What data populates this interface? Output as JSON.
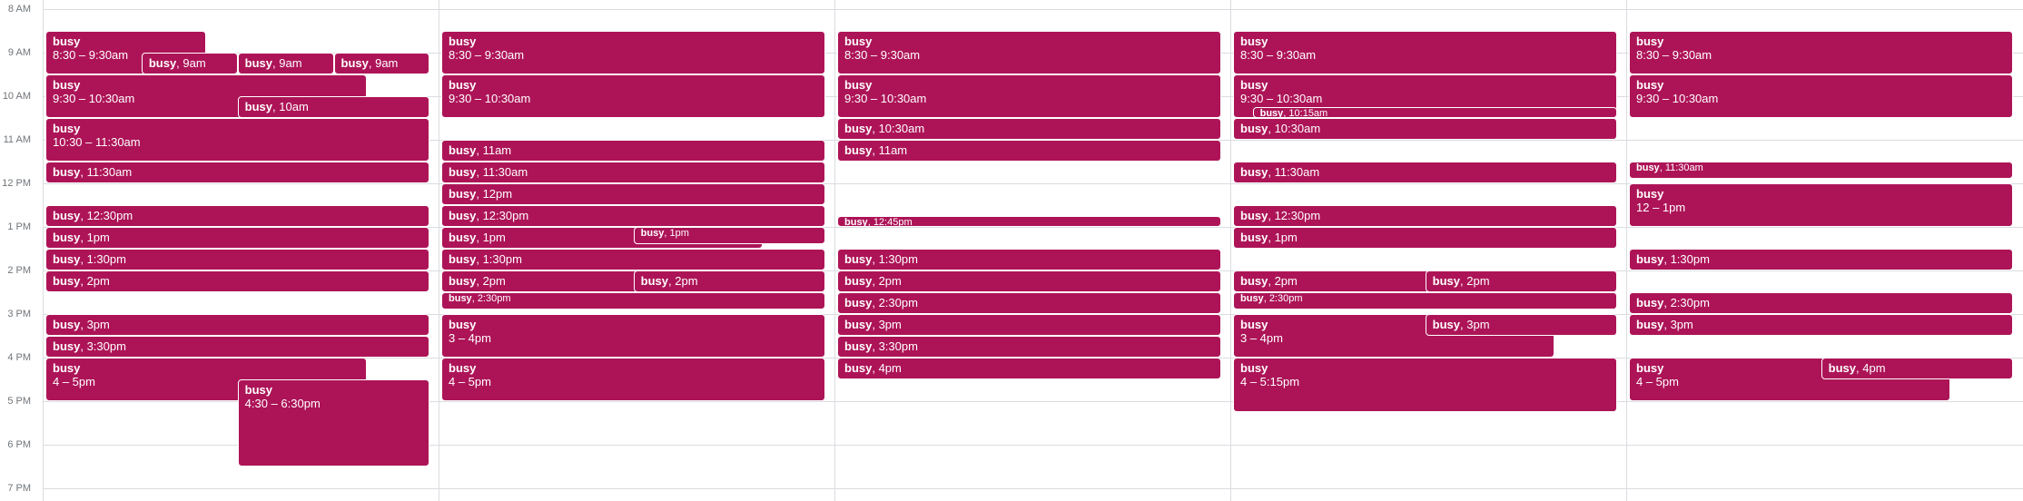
{
  "time_labels": [
    "8 AM",
    "9 AM",
    "10 AM",
    "11 AM",
    "12 PM",
    "1 PM",
    "2 PM",
    "3 PM",
    "4 PM",
    "5 PM",
    "6 PM",
    "7 PM"
  ],
  "event_title": "busy",
  "accent_color": "#ad1457",
  "days": [
    {
      "events": [
        {
          "title": "busy",
          "time": "8:30 – 9:30am",
          "start": 8.5,
          "end": 9.5,
          "lane": 0,
          "width": 0.41
        },
        {
          "title": "busy",
          "time": "9am",
          "start": 9.0,
          "end": 9.5,
          "lane": 0.245,
          "width": 0.245
        },
        {
          "title": "busy",
          "time": "9am",
          "start": 9.0,
          "end": 9.5,
          "lane": 0.49,
          "width": 0.245
        },
        {
          "title": "busy",
          "time": "9am",
          "start": 9.0,
          "end": 9.5,
          "lane": 0.735,
          "width": 0.245
        },
        {
          "title": "busy",
          "time": "9:30 – 10:30am",
          "start": 9.5,
          "end": 10.5,
          "lane": 0,
          "width": 0.82
        },
        {
          "title": "busy",
          "time": "10am",
          "start": 10.0,
          "end": 10.5,
          "lane": 0.49,
          "width": 0.49
        },
        {
          "title": "busy",
          "time": "10:30 – 11:30am",
          "start": 10.5,
          "end": 11.5,
          "lane": 0,
          "width": 0.98
        },
        {
          "title": "busy",
          "time": "11:30am",
          "start": 11.5,
          "end": 12.0,
          "lane": 0,
          "width": 0.98
        },
        {
          "title": "busy",
          "time": "12:30pm",
          "start": 12.5,
          "end": 13.0,
          "lane": 0,
          "width": 0.98
        },
        {
          "title": "busy",
          "time": "1pm",
          "start": 13.0,
          "end": 13.5,
          "lane": 0,
          "width": 0.98
        },
        {
          "title": "busy",
          "time": "1:30pm",
          "start": 13.5,
          "end": 14.0,
          "lane": 0,
          "width": 0.98
        },
        {
          "title": "busy",
          "time": "2pm",
          "start": 14.0,
          "end": 14.5,
          "lane": 0,
          "width": 0.98
        },
        {
          "title": "busy",
          "time": "3pm",
          "start": 15.0,
          "end": 15.5,
          "lane": 0,
          "width": 0.98
        },
        {
          "title": "busy",
          "time": "3:30pm",
          "start": 15.5,
          "end": 16.0,
          "lane": 0,
          "width": 0.98
        },
        {
          "title": "busy",
          "time": "4 – 5pm",
          "start": 16.0,
          "end": 17.0,
          "lane": 0,
          "width": 0.82
        },
        {
          "title": "busy",
          "time": "4:30 – 6:30pm",
          "start": 16.5,
          "end": 18.5,
          "lane": 0.49,
          "width": 0.49
        }
      ]
    },
    {
      "events": [
        {
          "title": "busy",
          "time": "8:30 – 9:30am",
          "start": 8.5,
          "end": 9.5,
          "lane": 0,
          "width": 0.98
        },
        {
          "title": "busy",
          "time": "9:30 – 10:30am",
          "start": 9.5,
          "end": 10.5,
          "lane": 0,
          "width": 0.98
        },
        {
          "title": "busy",
          "time": "11am",
          "start": 11.0,
          "end": 11.5,
          "lane": 0,
          "width": 0.98
        },
        {
          "title": "busy",
          "time": "11:30am",
          "start": 11.5,
          "end": 12.0,
          "lane": 0,
          "width": 0.98
        },
        {
          "title": "busy",
          "time": "12pm",
          "start": 12.0,
          "end": 12.5,
          "lane": 0,
          "width": 0.98
        },
        {
          "title": "busy",
          "time": "12:30pm",
          "start": 12.5,
          "end": 13.0,
          "lane": 0,
          "width": 0.98
        },
        {
          "title": "busy",
          "time": "1pm",
          "start": 13.0,
          "end": 13.5,
          "lane": 0,
          "width": 0.82
        },
        {
          "title": "busy",
          "time": "1pm",
          "start": 13.0,
          "end": 13.4,
          "lane": 0.49,
          "width": 0.49,
          "tiny": true
        },
        {
          "title": "busy",
          "time": "1:30pm",
          "start": 13.5,
          "end": 14.0,
          "lane": 0,
          "width": 0.98
        },
        {
          "title": "busy",
          "time": "2pm",
          "start": 14.0,
          "end": 14.5,
          "lane": 0,
          "width": 0.98
        },
        {
          "title": "busy",
          "time": "2pm",
          "start": 14.0,
          "end": 14.5,
          "lane": 0.49,
          "width": 0.49
        },
        {
          "title": "busy",
          "time": "2:30pm",
          "start": 14.5,
          "end": 14.9,
          "lane": 0,
          "width": 0.98,
          "tiny": true
        },
        {
          "title": "busy",
          "time": "3 – 4pm",
          "start": 15.0,
          "end": 16.0,
          "lane": 0,
          "width": 0.98
        },
        {
          "title": "busy",
          "time": "4 – 5pm",
          "start": 16.0,
          "end": 17.0,
          "lane": 0,
          "width": 0.98
        }
      ]
    },
    {
      "events": [
        {
          "title": "busy",
          "time": "8:30 – 9:30am",
          "start": 8.5,
          "end": 9.5,
          "lane": 0,
          "width": 0.98
        },
        {
          "title": "busy",
          "time": "9:30 – 10:30am",
          "start": 9.5,
          "end": 10.5,
          "lane": 0,
          "width": 0.98
        },
        {
          "title": "busy",
          "time": "10:30am",
          "start": 10.5,
          "end": 11.0,
          "lane": 0,
          "width": 0.98
        },
        {
          "title": "busy",
          "time": "11am",
          "start": 11.0,
          "end": 11.5,
          "lane": 0,
          "width": 0.98
        },
        {
          "title": "busy",
          "time": "12:45pm",
          "start": 12.75,
          "end": 13.0,
          "lane": 0,
          "width": 0.98,
          "tiny": true
        },
        {
          "title": "busy",
          "time": "1:30pm",
          "start": 13.5,
          "end": 14.0,
          "lane": 0,
          "width": 0.98
        },
        {
          "title": "busy",
          "time": "2pm",
          "start": 14.0,
          "end": 14.5,
          "lane": 0,
          "width": 0.98
        },
        {
          "title": "busy",
          "time": "2:30pm",
          "start": 14.5,
          "end": 15.0,
          "lane": 0,
          "width": 0.98
        },
        {
          "title": "busy",
          "time": "3pm",
          "start": 15.0,
          "end": 15.5,
          "lane": 0,
          "width": 0.98
        },
        {
          "title": "busy",
          "time": "3:30pm",
          "start": 15.5,
          "end": 16.0,
          "lane": 0,
          "width": 0.98
        },
        {
          "title": "busy",
          "time": "4pm",
          "start": 16.0,
          "end": 16.5,
          "lane": 0,
          "width": 0.98
        }
      ]
    },
    {
      "events": [
        {
          "title": "busy",
          "time": "8:30 – 9:30am",
          "start": 8.5,
          "end": 9.5,
          "lane": 0,
          "width": 0.98
        },
        {
          "title": "busy",
          "time": "9:30 – 10:30am",
          "start": 9.5,
          "end": 10.5,
          "lane": 0,
          "width": 0.98
        },
        {
          "title": "busy",
          "time": "10:15am",
          "start": 10.25,
          "end": 10.5,
          "lane": 0.05,
          "width": 0.93,
          "tiny": true
        },
        {
          "title": "busy",
          "time": "10:30am",
          "start": 10.5,
          "end": 11.0,
          "lane": 0,
          "width": 0.98
        },
        {
          "title": "busy",
          "time": "11:30am",
          "start": 11.5,
          "end": 12.0,
          "lane": 0,
          "width": 0.98
        },
        {
          "title": "busy",
          "time": "12:30pm",
          "start": 12.5,
          "end": 13.0,
          "lane": 0,
          "width": 0.98
        },
        {
          "title": "busy",
          "time": "1pm",
          "start": 13.0,
          "end": 13.5,
          "lane": 0,
          "width": 0.98
        },
        {
          "title": "busy",
          "time": "2pm",
          "start": 14.0,
          "end": 14.5,
          "lane": 0,
          "width": 0.98
        },
        {
          "title": "busy",
          "time": "2pm",
          "start": 14.0,
          "end": 14.5,
          "lane": 0.49,
          "width": 0.49
        },
        {
          "title": "busy",
          "time": "2:30pm",
          "start": 14.5,
          "end": 14.9,
          "lane": 0,
          "width": 0.98,
          "tiny": true
        },
        {
          "title": "busy",
          "time": "3 – 4pm",
          "start": 15.0,
          "end": 16.0,
          "lane": 0,
          "width": 0.82
        },
        {
          "title": "busy",
          "time": "3pm",
          "start": 15.0,
          "end": 15.5,
          "lane": 0.49,
          "width": 0.49
        },
        {
          "title": "busy",
          "time": "4 – 5:15pm",
          "start": 16.0,
          "end": 17.25,
          "lane": 0,
          "width": 0.98
        }
      ]
    },
    {
      "events": [
        {
          "title": "busy",
          "time": "8:30 – 9:30am",
          "start": 8.5,
          "end": 9.5,
          "lane": 0,
          "width": 0.98
        },
        {
          "title": "busy",
          "time": "9:30 – 10:30am",
          "start": 9.5,
          "end": 10.5,
          "lane": 0,
          "width": 0.98
        },
        {
          "title": "busy",
          "time": "11:30am",
          "start": 11.5,
          "end": 11.9,
          "lane": 0,
          "width": 0.98,
          "tiny": true
        },
        {
          "title": "busy",
          "time": "12 – 1pm",
          "start": 12.0,
          "end": 13.0,
          "lane": 0,
          "width": 0.98
        },
        {
          "title": "busy",
          "time": "1:30pm",
          "start": 13.5,
          "end": 14.0,
          "lane": 0,
          "width": 0.98
        },
        {
          "title": "busy",
          "time": "2:30pm",
          "start": 14.5,
          "end": 15.0,
          "lane": 0,
          "width": 0.98
        },
        {
          "title": "busy",
          "time": "3pm",
          "start": 15.0,
          "end": 15.5,
          "lane": 0,
          "width": 0.98
        },
        {
          "title": "busy",
          "time": "4 – 5pm",
          "start": 16.0,
          "end": 17.0,
          "lane": 0,
          "width": 0.82
        },
        {
          "title": "busy",
          "time": "4pm",
          "start": 16.0,
          "end": 16.5,
          "lane": 0.49,
          "width": 0.49
        }
      ]
    }
  ]
}
